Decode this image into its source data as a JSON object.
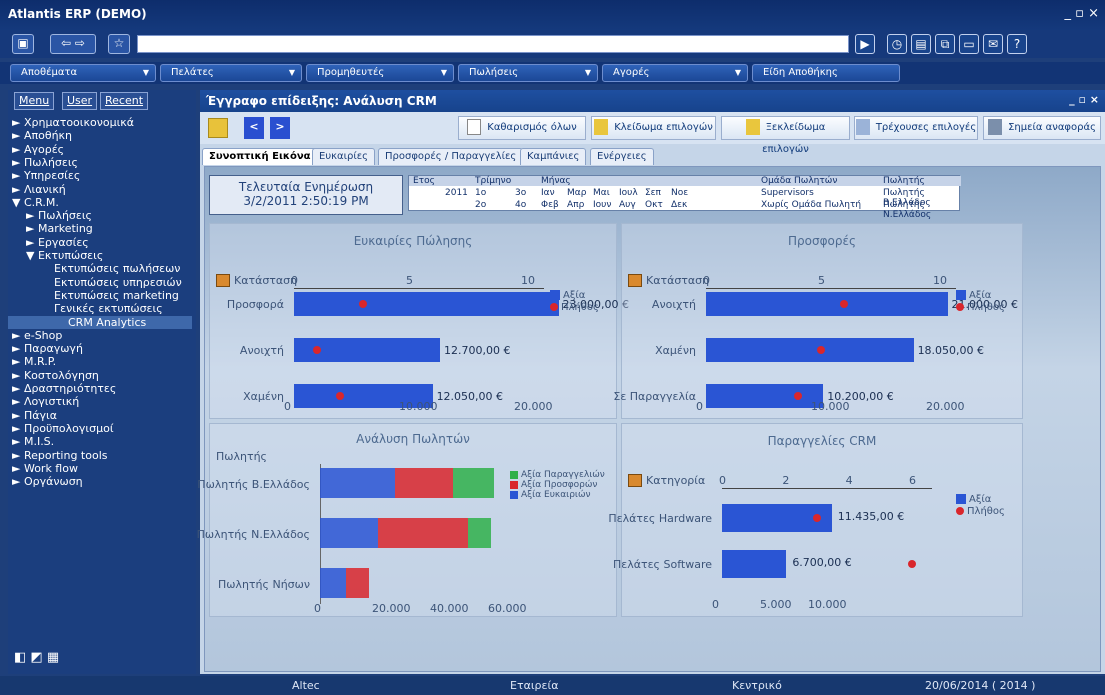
{
  "window": {
    "title": "Atlantis ERP (DEMO)",
    "controls": "_ ▫ ×"
  },
  "menubar": [
    "Αποθέματα",
    "Πελάτες",
    "Προμηθευτές",
    "Πωλήσεις",
    "Αγορές",
    "Είδη Αποθήκης"
  ],
  "sidebar": {
    "tabs": [
      "Menu",
      "User",
      "Recent"
    ],
    "items": [
      "► Χρηματοοικονομικά",
      "► Αποθήκη",
      "► Αγορές",
      "► Πωλήσεις",
      "► Υπηρεσίες",
      "► Λιανική",
      "▼ C.R.M.",
      "► Πωλήσεις",
      "► Marketing",
      "► Εργασίες",
      "▼ Εκτυπώσεις",
      "Εκτυπώσεις πωλήσεων",
      "Εκτυπώσεις υπηρεσιών",
      "Εκτυπώσεις marketing",
      "Γενικές εκτυπώσεις",
      "CRM Analytics",
      "► e-Shop",
      "► Παραγωγή",
      "► M.R.P.",
      "► Κοστολόγηση",
      "► Δραστηριότητες",
      "► Λογιστική",
      "► Πάγια",
      "► Προϋπολογισμοί",
      "► M.I.S.",
      "► Reporting tools",
      "► Work flow",
      "► Οργάνωση"
    ]
  },
  "doc": {
    "title": "Έγγραφο επίδειξης: Ανάλυση CRM"
  },
  "toolbar": {
    "clear": "Καθαρισμός όλων",
    "lock": "Κλείδωμα επιλογών",
    "unlock": "Ξεκλείδωμα επιλογών",
    "current": "Τρέχουσες επιλογές",
    "bookmarks": "Σημεία αναφοράς"
  },
  "tabs": [
    "Συνοπτική Εικόνα",
    "Ευκαιρίες",
    "Προσφορές / Παραγγελίες",
    "Καμπάνιες",
    "Ενέργειες"
  ],
  "lastupdate": {
    "label": "Τελευταία Ενημέρωση",
    "value": "3/2/2011 2:50:19 PM"
  },
  "filters": {
    "year_h": "Ετος",
    "year": "2011",
    "quarter_h": "Τρίμηνο",
    "quarters": [
      "1ο",
      "3ο",
      "2ο",
      "4ο"
    ],
    "month_h": "Μήνας",
    "months": [
      "Ιαν",
      "Μαρ",
      "Μαι",
      "Ιουλ",
      "Σεπ",
      "Νοε",
      "Φεβ",
      "Απρ",
      "Ιουν",
      "Αυγ",
      "Οκτ",
      "Δεκ"
    ],
    "group_h": "Ομάδα Πωλητών",
    "groups": [
      "Supervisors",
      "Χωρίς Ομάδα Πωλητή"
    ],
    "seller_h": "Πωλητής",
    "sellers": [
      "Πωλητής Β.Ελλάδος",
      "Πωλητής Ν.Ελλάδος"
    ]
  },
  "chart_data": [
    {
      "type": "bar",
      "title": "Ευκαιρίες Πώλησης",
      "categories": [
        "Προσφορά",
        "Ανοιχτή",
        "Χαμένη"
      ],
      "series": [
        {
          "name": "Αξία",
          "values": [
            23000,
            12700,
            12050
          ]
        },
        {
          "name": "Πλήθος",
          "values": [
            3,
            1,
            2
          ]
        }
      ],
      "value_labels": [
        "23.000,00 €",
        "12.700,00 €",
        "12.050,00 €"
      ],
      "xticks_bottom": [
        "0",
        "10.000",
        "20.000"
      ],
      "xticks_top": [
        "0",
        "5",
        "10"
      ],
      "dim_label": "Κατάσταση"
    },
    {
      "type": "bar",
      "title": "Προσφορές",
      "categories": [
        "Ανοιχτή",
        "Χαμένη",
        "Σε Παραγγελία"
      ],
      "series": [
        {
          "name": "Αξία",
          "values": [
            21000,
            18050,
            10200
          ]
        },
        {
          "name": "Πλήθος",
          "values": [
            6,
            5,
            4
          ]
        }
      ],
      "value_labels": [
        "21.000,00 €",
        "18.050,00 €",
        "10.200,00 €"
      ],
      "xticks_bottom": [
        "0",
        "10.000",
        "20.000"
      ],
      "xticks_top": [
        "0",
        "5",
        "10"
      ],
      "dim_label": "Κατάσταση"
    },
    {
      "type": "bar",
      "title": "Ανάλυση Πωλητών",
      "categories": [
        "Πωλητής Β.Ελλάδος",
        "Πωλητής Ν.Ελλάδος",
        "Πωλητής Νήσων"
      ],
      "series": [
        {
          "name": "Αξία Ευκαιριών",
          "values": [
            26000,
            20000,
            9000
          ]
        },
        {
          "name": "Αξία Προσφορών",
          "values": [
            20000,
            31000,
            8000
          ]
        },
        {
          "name": "Αξία Παραγγελιών",
          "values": [
            14000,
            8000,
            0
          ]
        }
      ],
      "xticks": [
        "0",
        "20.000",
        "40.000",
        "60.000"
      ],
      "dim_label": "Πωλητής"
    },
    {
      "type": "bar",
      "title": "Παραγγελίες CRM",
      "categories": [
        "Πελάτες Hardware",
        "Πελάτες Software"
      ],
      "series": [
        {
          "name": "Αξία",
          "values": [
            11435,
            6700
          ]
        },
        {
          "name": "Πλήθος",
          "values": [
            3,
            6
          ]
        }
      ],
      "value_labels": [
        "11.435,00 €",
        "6.700,00 €"
      ],
      "xticks_bottom": [
        "0",
        "5.000",
        "10.000"
      ],
      "xticks_top": [
        "0",
        "2",
        "4",
        "6"
      ],
      "dim_label": "Κατηγορία"
    }
  ],
  "legend": {
    "value": "Αξία",
    "count": "Πλήθος"
  },
  "status": [
    "Altec",
    "Εταιρεία",
    "Κεντρικό",
    "20/06/2014 ( 2014 )"
  ]
}
